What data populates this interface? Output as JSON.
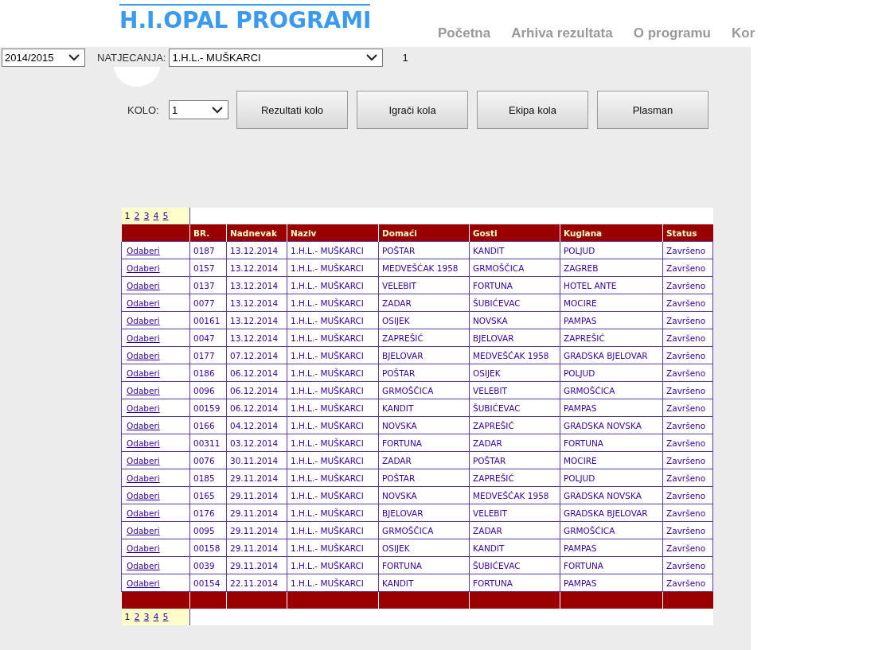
{
  "header": {
    "title": "H.I.OPAL PROGRAMI",
    "nav": [
      "Početna",
      "Arhiva rezultata",
      "O programu",
      "Kor"
    ]
  },
  "filters": {
    "season": "2014/2015",
    "competition_label": "NATJECANJA:",
    "competition": "1.H.L.- MUŠKARCI",
    "count": "1"
  },
  "round": {
    "label": "KOLO:",
    "value": "1",
    "buttons": [
      "Rezultati kolo",
      "Igrači kola",
      "Ekipa kola",
      "Plasman"
    ]
  },
  "table": {
    "pager_top": [
      {
        "label": "1",
        "selected": true
      },
      {
        "label": "2",
        "selected": false
      },
      {
        "label": "3",
        "selected": false
      },
      {
        "label": "4",
        "selected": false
      },
      {
        "label": "5",
        "selected": false
      }
    ],
    "columns": [
      "BR.",
      "Nadnevak",
      "Naziv",
      "Domaći",
      "Gosti",
      "Kuglana",
      "Status"
    ],
    "rows": [
      {
        "action": "Odaberi",
        "cells": [
          "0187",
          "13.12.2014",
          "1.H.L.- MUŠKARCI",
          "POŠTAR",
          "KANDIT",
          "POLJUD",
          "Završeno"
        ]
      },
      {
        "action": "Odaberi",
        "cells": [
          "0157",
          "13.12.2014",
          "1.H.L.- MUŠKARCI",
          "MEDVEŠĆAK 1958",
          "GRMOŠČICA",
          "ZAGREB",
          "Završeno"
        ]
      },
      {
        "action": "Odaberi",
        "cells": [
          "0137",
          "13.12.2014",
          "1.H.L.- MUŠKARCI",
          "VELEBIT",
          "FORTUNA",
          "HOTEL ANTE",
          "Završeno"
        ]
      },
      {
        "action": "Odaberi",
        "cells": [
          "0077",
          "13.12.2014",
          "1.H.L.- MUŠKARCI",
          "ZADAR",
          "ŠUBIĆEVAC",
          "MOCIRE",
          "Završeno"
        ]
      },
      {
        "action": "Odaberi",
        "cells": [
          "00161",
          "13.12.2014",
          "1.H.L.- MUŠKARCI",
          "OSIJEK",
          "NOVSKA",
          "PAMPAS",
          "Završeno"
        ]
      },
      {
        "action": "Odaberi",
        "cells": [
          "0047",
          "13.12.2014",
          "1.H.L.- MUŠKARCI",
          "ZAPREŠIĆ",
          "BJELOVAR",
          "ZAPREŠIĆ",
          "Završeno"
        ]
      },
      {
        "action": "Odaberi",
        "cells": [
          "0177",
          "07.12.2014",
          "1.H.L.- MUŠKARCI",
          "BJELOVAR",
          "MEDVEŠĆAK 1958",
          "GRADSKA BJELOVAR",
          "Završeno"
        ]
      },
      {
        "action": "Odaberi",
        "cells": [
          "0186",
          "06.12.2014",
          "1.H.L.- MUŠKARCI",
          "POŠTAR",
          "OSIJEK",
          "POLJUD",
          "Završeno"
        ]
      },
      {
        "action": "Odaberi",
        "cells": [
          "0096",
          "06.12.2014",
          "1.H.L.- MUŠKARCI",
          "GRMOŠČICA",
          "VELEBIT",
          "GRMOŠĆICA",
          "Završeno"
        ]
      },
      {
        "action": "Odaberi",
        "cells": [
          "00159",
          "06.12.2014",
          "1.H.L.- MUŠKARCI",
          "KANDIT",
          "ŠUBIĆEVAC",
          "PAMPAS",
          "Završeno"
        ]
      },
      {
        "action": "Odaberi",
        "cells": [
          "0166",
          "04.12.2014",
          "1.H.L.- MUŠKARCI",
          "NOVSKA",
          "ZAPREŠIĆ",
          "GRADSKA NOVSKA",
          "Završeno"
        ]
      },
      {
        "action": "Odaberi",
        "cells": [
          "00311",
          "03.12.2014",
          "1.H.L.- MUŠKARCI",
          "FORTUNA",
          "ZADAR",
          "FORTUNA",
          "Završeno"
        ]
      },
      {
        "action": "Odaberi",
        "cells": [
          "0076",
          "30.11.2014",
          "1.H.L.- MUŠKARCI",
          "ZADAR",
          "POŠTAR",
          "MOCIRE",
          "Završeno"
        ]
      },
      {
        "action": "Odaberi",
        "cells": [
          "0185",
          "29.11.2014",
          "1.H.L.- MUŠKARCI",
          "POŠTAR",
          "ZAPREŠIĆ",
          "POLJUD",
          "Završeno"
        ]
      },
      {
        "action": "Odaberi",
        "cells": [
          "0165",
          "29.11.2014",
          "1.H.L.- MUŠKARCI",
          "NOVSKA",
          "MEDVEŠĆAK 1958",
          "GRADSKA NOVSKA",
          "Završeno"
        ]
      },
      {
        "action": "Odaberi",
        "cells": [
          "0176",
          "29.11.2014",
          "1.H.L.- MUŠKARCI",
          "BJELOVAR",
          "VELEBIT",
          "GRADSKA BJELOVAR",
          "Završeno"
        ]
      },
      {
        "action": "Odaberi",
        "cells": [
          "0095",
          "29.11.2014",
          "1.H.L.- MUŠKARCI",
          "GRMOŠČICA",
          "ZADAR",
          "GRMOŠĆICA",
          "Završeno"
        ]
      },
      {
        "action": "Odaberi",
        "cells": [
          "00158",
          "29.11.2014",
          "1.H.L.- MUŠKARCI",
          "OSIJEK",
          "KANDIT",
          "PAMPAS",
          "Završeno"
        ]
      },
      {
        "action": "Odaberi",
        "cells": [
          "0039",
          "29.11.2014",
          "1.H.L.- MUŠKARCI",
          "FORTUNA",
          "ŠUBIĆEVAC",
          "FORTUNA",
          "Završeno"
        ]
      },
      {
        "action": "Odaberi",
        "cells": [
          "00154",
          "22.11.2014",
          "1.H.L.- MUŠKARCI",
          "KANDIT",
          "FORTUNA",
          "PAMPAS",
          "Završeno"
        ]
      }
    ],
    "pager_bottom": [
      {
        "label": "1",
        "selected": true
      },
      {
        "label": "2",
        "selected": false
      },
      {
        "label": "3",
        "selected": false
      },
      {
        "label": "4",
        "selected": false
      },
      {
        "label": "5",
        "selected": false
      }
    ]
  }
}
